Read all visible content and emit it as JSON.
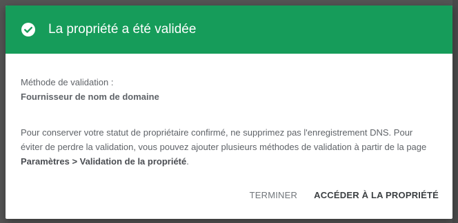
{
  "dialog": {
    "title": "La propriété a été validée",
    "header_color": "#169c5a",
    "icon": "check-circle-icon",
    "method_label": "Méthode de validation :",
    "method_value": "Fournisseur de nom de domaine",
    "paragraph": {
      "line1": "Pour conserver votre statut de propriétaire confirmé, ne supprimez pas l'enregistrement DNS.",
      "line2_prefix": "Pour éviter de perdre la validation, vous pouvez ajouter plusieurs méthodes de validation à partir de la page ",
      "link_text": "Paramètres > Validation de la propriété",
      "line2_suffix": "."
    },
    "actions": {
      "terminate_label": "TERMINER",
      "access_label": "ACCÉDER À LA PROPRIÉTÉ"
    }
  }
}
